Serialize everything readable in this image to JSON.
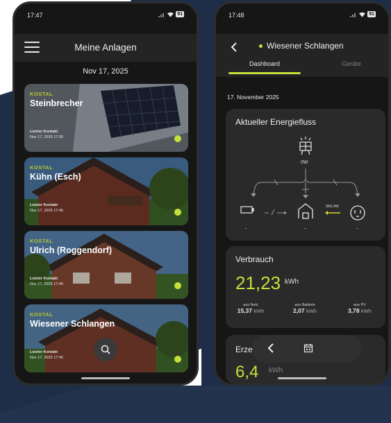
{
  "phone_left": {
    "status": {
      "time": "17:47",
      "battery": "91"
    },
    "header": {
      "title": "Meine Anlagen"
    },
    "date": "Nov 17, 2025",
    "cards": [
      {
        "brand": "KOSTAL",
        "name": "Steinbrecher",
        "last_contact_label": "Letzter Kontakt",
        "last_contact_time": "Nov 17, 2025 17:35"
      },
      {
        "brand": "KOSTAL",
        "name": "Kühn (Esch)",
        "last_contact_label": "Letzter Kontakt",
        "last_contact_time": "Nov 17, 2025 17:45"
      },
      {
        "brand": "KOSTAL",
        "name": "Ulrich (Roggendorf)",
        "last_contact_label": "Letzter Kontakt",
        "last_contact_time": "Nov 17, 2025 17:45"
      },
      {
        "brand": "KOSTAL",
        "name": "Wiesener Schlangen",
        "last_contact_label": "Letzter Kontakt",
        "last_contact_time": "Nov 17, 2025 17:45"
      }
    ],
    "search_icon": "search-icon"
  },
  "phone_right": {
    "status": {
      "time": "17:48",
      "battery": "91"
    },
    "header": {
      "title": "Wiesener Schlangen"
    },
    "tabs": [
      {
        "label": "Dashboard",
        "active": true
      },
      {
        "label": "Geräte",
        "active": false
      }
    ],
    "date": "17. November 2025",
    "energy_flow": {
      "title": "Aktueller Energiefluss",
      "pv_power": "0W",
      "grid_power": "560,4W",
      "battery_value": "-",
      "house_value": "-",
      "grid_value": "-"
    },
    "consumption": {
      "title": "Verbrauch",
      "value": "21,23",
      "unit": "kWh",
      "sources": [
        {
          "label": "aus Netz",
          "value": "15,37",
          "unit": "kWh"
        },
        {
          "label": "aus Batterie",
          "value": "2,07",
          "unit": "kWh"
        },
        {
          "label": "aus PV",
          "value": "3,78",
          "unit": "kWh"
        }
      ]
    },
    "generation": {
      "title": "Erze",
      "value": "6,4",
      "unit": "kWh"
    }
  },
  "colors": {
    "accent": "#c4e03a",
    "background": "#161616",
    "panel": "#2a2a2a"
  }
}
